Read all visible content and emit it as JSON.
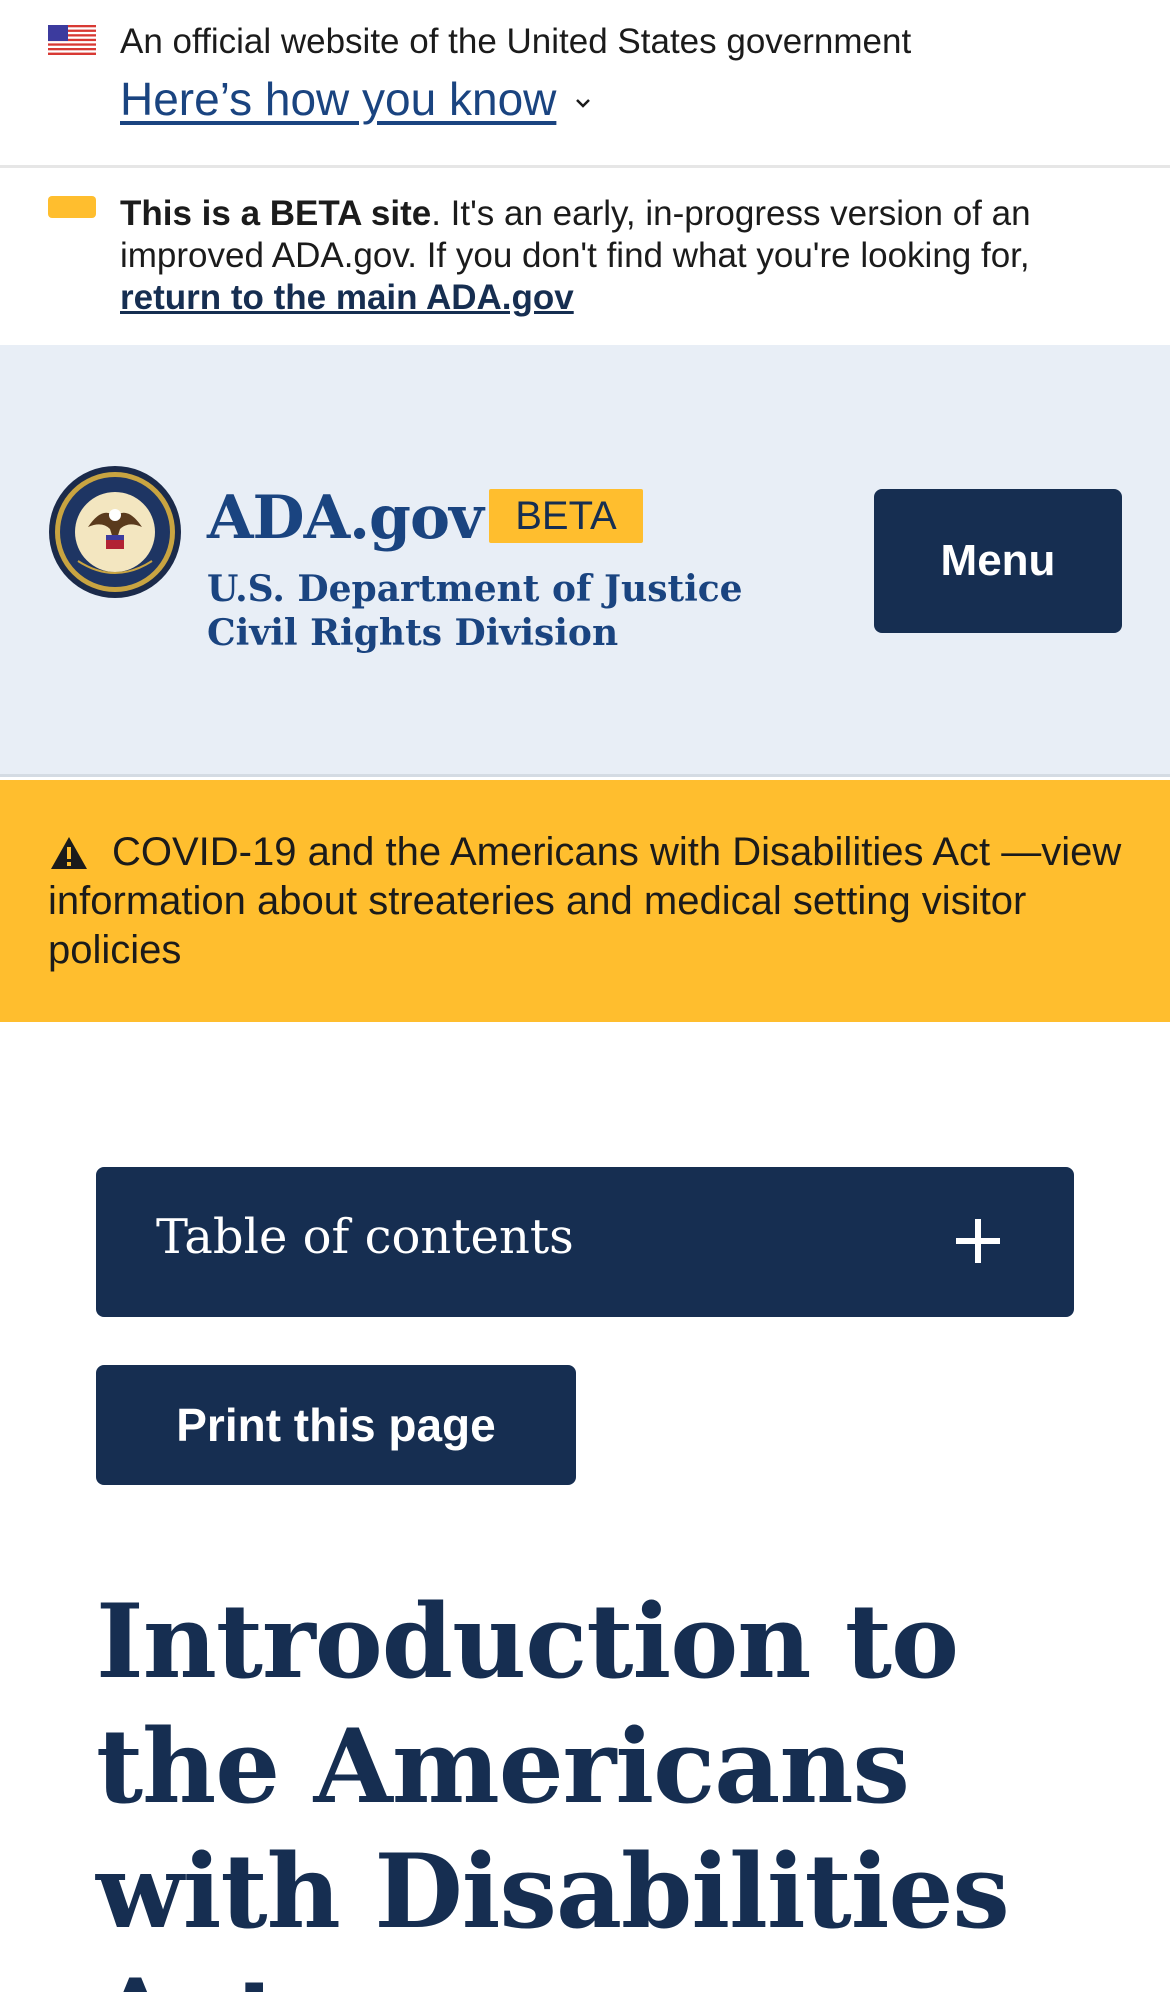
{
  "gov_banner": {
    "official_text": "An official website of the United States government",
    "how_you_know": "Here’s how you know"
  },
  "beta_banner": {
    "bold_text": "This is a BETA site",
    "body_text": ". It's an early, in-progress version of an improved ADA.gov. If you don't find what you're looking for, ",
    "link_text": "return to the main ADA.gov"
  },
  "header": {
    "site_name": "ADA.gov",
    "beta_tag": "BETA",
    "dept_line1": "U.S. Department of Justice",
    "dept_line2": "Civil Rights Division",
    "menu_label": "Menu",
    "seal_text": "DEPARTMENT OF JUSTICE"
  },
  "alert": {
    "icon": "warning-icon",
    "text": "COVID-19 and the Americans with Disabilities Act —view information about streateries and medical setting visitor policies"
  },
  "main": {
    "toc_label": "Table of contents",
    "print_label": "Print this page",
    "title": "Introduction to the Americans with Disabilities Act"
  },
  "colors": {
    "navy": "#162e51",
    "link_blue": "#1a4480",
    "gold": "#ffbe2e",
    "header_bg": "#e8eef6"
  }
}
